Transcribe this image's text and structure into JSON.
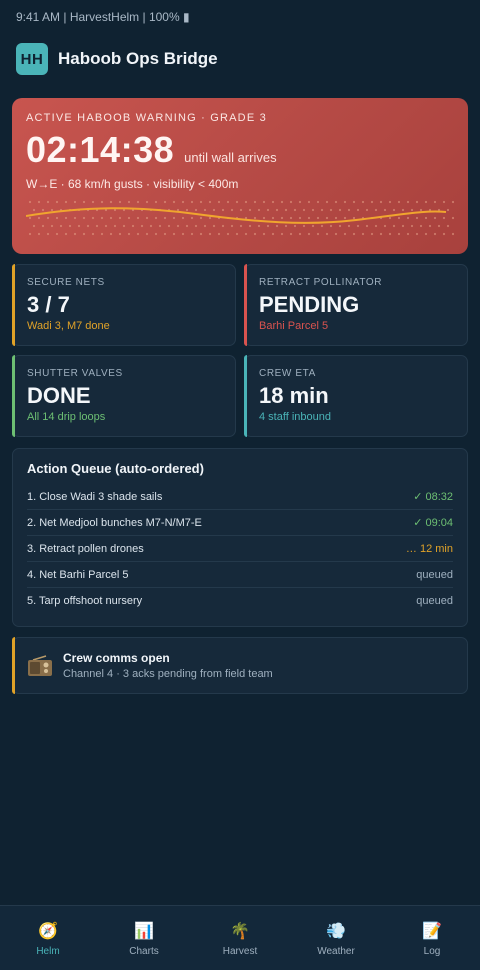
{
  "status_bar": {
    "text": "9:41 AM | HarvestHelm | 100% ▮"
  },
  "header": {
    "logo": "HH",
    "title": "Haboob Ops Bridge"
  },
  "warning": {
    "eyebrow": "ACTIVE HABOOB WARNING · GRADE 3",
    "countdown": "02:14:38",
    "countdown_sub": "until wall arrives",
    "meta": "W→E · 68 km/h gusts · visibility < 400m"
  },
  "tiles": [
    {
      "label": "SECURE NETS",
      "value": "3 / 7",
      "sub": "Wadi 3, M7 done",
      "accent": "#e0a228"
    },
    {
      "label": "RETRACT POLLINATOR",
      "value": "PENDING",
      "sub": "Barhi Parcel 5",
      "accent": "#d9534f"
    },
    {
      "label": "SHUTTER VALVES",
      "value": "DONE",
      "sub": "All 14 drip loops",
      "accent": "#6dbf73"
    },
    {
      "label": "CREW ETA",
      "value": "18 min",
      "sub": "4 staff inbound",
      "accent": "#4ab4b8"
    }
  ],
  "queue": {
    "title": "Action Queue (auto-ordered)",
    "items": [
      {
        "label": "1. Close Wadi 3 shade sails",
        "status": "✓ 08:32",
        "color": "#6dbf73"
      },
      {
        "label": "2. Net Medjool bunches M7-N/M7-E",
        "status": "✓ 09:04",
        "color": "#6dbf73"
      },
      {
        "label": "3. Retract pollen drones",
        "status": "… 12 min",
        "color": "#e0a228"
      },
      {
        "label": "4. Net Barhi Parcel 5",
        "status": "queued",
        "color": "#9fb0bf"
      },
      {
        "label": "5. Tarp offshoot nursery",
        "status": "queued",
        "color": "#9fb0bf"
      }
    ]
  },
  "comms": {
    "icon": "radio-icon",
    "title": "Crew comms open",
    "subtitle": "Channel 4 · 3 acks pending from field team"
  },
  "tabs": [
    {
      "label": "Helm",
      "icon": "compass-icon",
      "glyph": "🧭",
      "active": true
    },
    {
      "label": "Charts",
      "icon": "bar-chart-icon",
      "glyph": "📊",
      "active": false
    },
    {
      "label": "Harvest",
      "icon": "palm-tree-icon",
      "glyph": "🌴",
      "active": false
    },
    {
      "label": "Weather",
      "icon": "wind-cloud-icon",
      "glyph": "💨",
      "active": false
    },
    {
      "label": "Log",
      "icon": "memo-icon",
      "glyph": "📝",
      "active": false
    }
  ],
  "colors": {
    "background": "#0f2231",
    "card": "#16293a",
    "accent_teal": "#4ab4b8",
    "warning_red": "#c8554f",
    "amber": "#e0a228",
    "green": "#6dbf73"
  }
}
